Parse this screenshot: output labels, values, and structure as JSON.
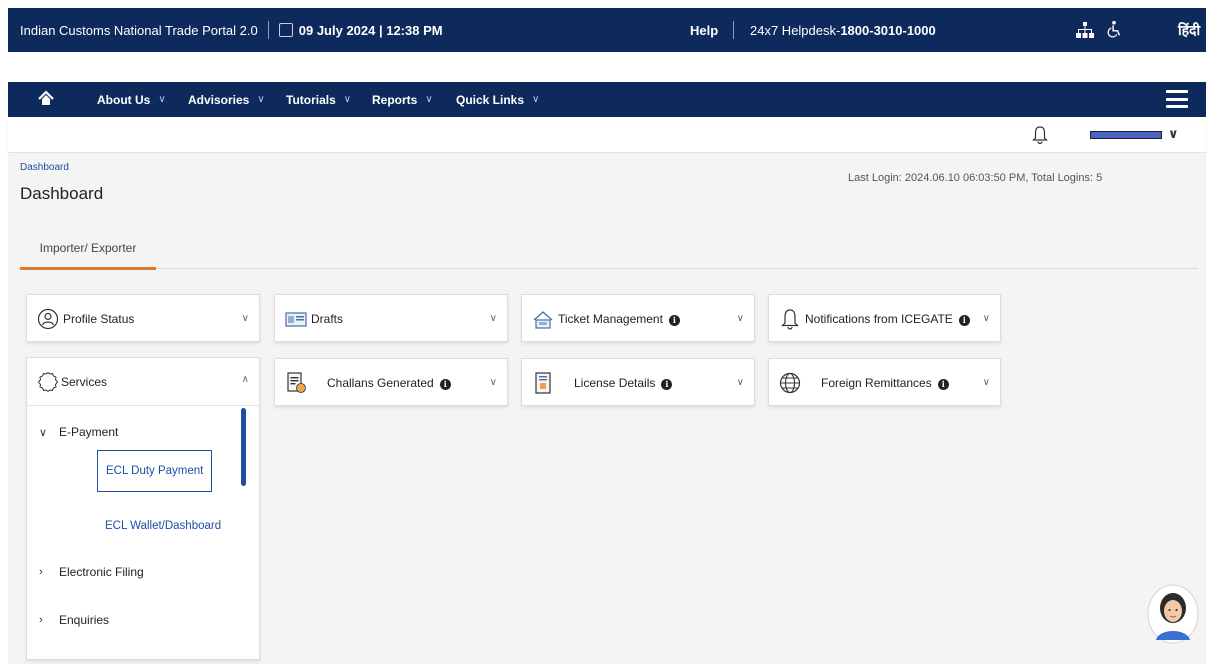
{
  "topbar": {
    "portal_title": "Indian Customs National Trade Portal 2.0",
    "datetime": "09 July 2024 | 12:38 PM",
    "help_label": "Help",
    "helpdesk_prefix": "24x7 Helpdesk-",
    "helpdesk_number": "1800-3010-1000",
    "language_label": "हिंदी",
    "icons": [
      "calendar-icon",
      "sitemap-icon",
      "accessibility-icon"
    ]
  },
  "nav": {
    "items": [
      {
        "label": "About Us"
      },
      {
        "label": "Advisories"
      },
      {
        "label": "Tutorials"
      },
      {
        "label": "Reports"
      },
      {
        "label": "Quick Links"
      }
    ],
    "icons": [
      "home-icon",
      "hamburger-menu-icon"
    ]
  },
  "user": {
    "icons": [
      "bell-icon",
      "chevron-down-icon"
    ]
  },
  "breadcrumb": "Dashboard",
  "page_title": "Dashboard",
  "last_login": "Last Login: 2024.06.10 06:03:50 PM, Total Logins: 5",
  "tabs": [
    {
      "label": "Importer/ Exporter",
      "active": true
    }
  ],
  "cards": {
    "profile_status": "Profile Status",
    "drafts": "Drafts",
    "ticket_management": "Ticket Management",
    "notifications": "Notifications from ICEGATE",
    "challans": "Challans Generated",
    "license": "License Details",
    "foreign_remittances": "Foreign Remittances",
    "info_glyph": "i"
  },
  "services": {
    "title": "Services",
    "tree": {
      "epayment": "E-Payment",
      "ecl_duty_payment": "ECL Duty Payment",
      "ecl_wallet": "ECL Wallet/Dashboard",
      "electronic_filing": "Electronic Filing",
      "enquiries": "Enquiries"
    }
  },
  "colors": {
    "navy": "#0e2a5c",
    "accent_orange": "#e07a2d",
    "link_blue": "#1f4ea1",
    "page_bg": "#f4f4f4"
  }
}
